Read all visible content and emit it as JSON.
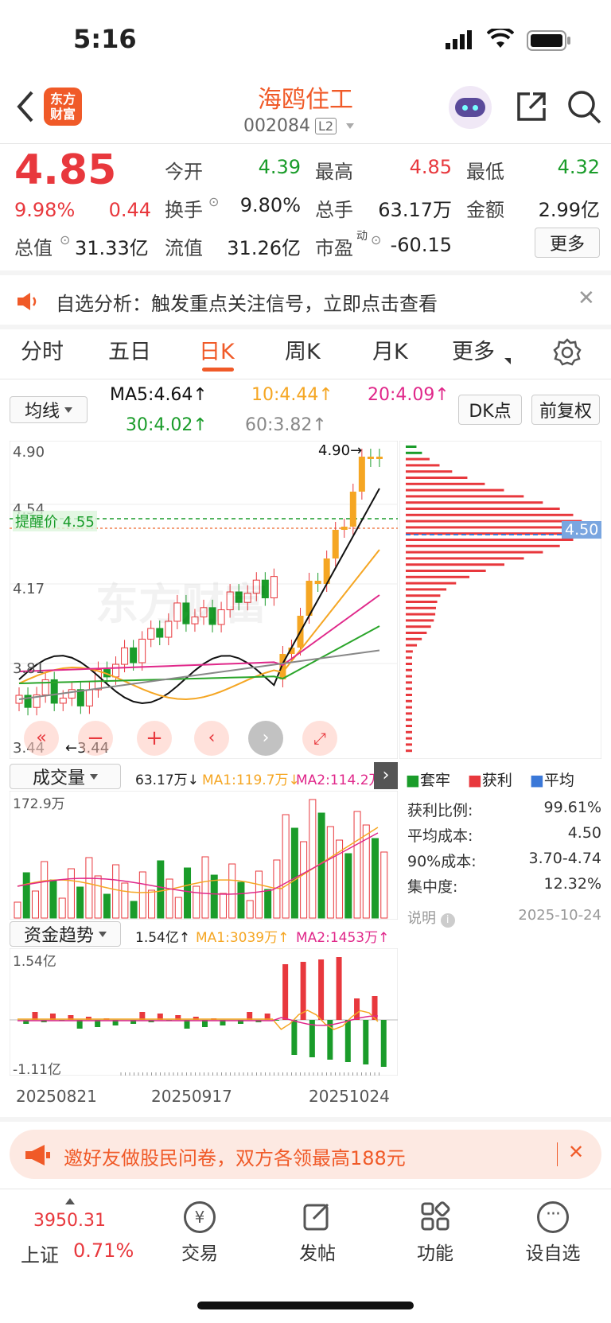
{
  "status_bar": {
    "time": "5:16"
  },
  "header": {
    "logo": "东方\n财富",
    "stock_name": "海鸥住工",
    "stock_code": "002084",
    "level_badge": "L2"
  },
  "quote": {
    "price": "4.85",
    "change_pct": "9.98%",
    "change_amt": "0.44",
    "open_label": "今开",
    "open": "4.39",
    "high_label": "最高",
    "high": "4.85",
    "low_label": "最低",
    "low": "4.32",
    "turnover_label": "换手",
    "turnover": "9.80%",
    "volume_label": "总手",
    "volume": "63.17万",
    "amount_label": "金额",
    "amount": "2.99亿",
    "mktcap_label": "总值",
    "mktcap": "31.33亿",
    "float_label": "流值",
    "float_cap": "31.26亿",
    "pe_label": "市盈",
    "pe_sup": "动",
    "pe": "-60.15",
    "more_button": "更多"
  },
  "banner": {
    "text": "自选分析：触发重点关注信号，立即点击查看"
  },
  "tabs": [
    "分时",
    "五日",
    "日K",
    "周K",
    "月K",
    "更多"
  ],
  "active_tab": "日K",
  "ma_bar": {
    "selector": "均线",
    "ma5": "MA5:4.64↑",
    "ma10": "10:4.44↑",
    "ma20": "20:4.09↑",
    "ma30": "30:4.02↑",
    "ma60": "60:3.82↑",
    "dk_button": "DK点",
    "adjust_button": "前复权"
  },
  "kchart": {
    "y_labels": [
      "4.90",
      "4.54",
      "4.17",
      "3.81",
      "3.44"
    ],
    "alert_label": "提醒价 4.55",
    "high_marker": "4.90→",
    "low_marker": "←3.44",
    "cost_label": "4.50",
    "colors": {
      "up": "#e8383d",
      "down": "#1a9c2a",
      "ma5": "#111111",
      "ma10": "#f5a623",
      "ma20": "#e0288a",
      "ma30": "#2aa52a",
      "ma60": "#888888"
    }
  },
  "volume_panel": {
    "selector": "成交量",
    "value": "63.17万↓",
    "ma1": "MA1:119.7万↓",
    "ma2": "MA2:114.2万↑",
    "max_label": "172.9万"
  },
  "fund_panel": {
    "selector": "资金趋势",
    "value": "1.54亿↑",
    "ma1": "MA1:3039万↑",
    "ma2": "MA2:1453万↑",
    "max_label": "1.54亿",
    "min_label": "-1.11亿"
  },
  "dates": [
    "20250821",
    "20250917",
    "20251024"
  ],
  "chips": {
    "legend": [
      "套牢",
      "获利",
      "平均"
    ],
    "rows": [
      {
        "label": "获利比例:",
        "value": "99.61%"
      },
      {
        "label": "平均成本:",
        "value": "4.50"
      },
      {
        "label": "90%成本:",
        "value": "3.70-4.74"
      },
      {
        "label": "集中度:",
        "value": "12.32%"
      }
    ],
    "note": "说明",
    "date": "2025-10-24"
  },
  "promo": {
    "text": "邀好友做股民问卷，双方各领最高188元"
  },
  "bottom_nav": {
    "index_value": "3950.31",
    "index_name": "上证",
    "index_change": "0.71%",
    "items": [
      "交易",
      "发帖",
      "功能",
      "设自选"
    ]
  }
}
